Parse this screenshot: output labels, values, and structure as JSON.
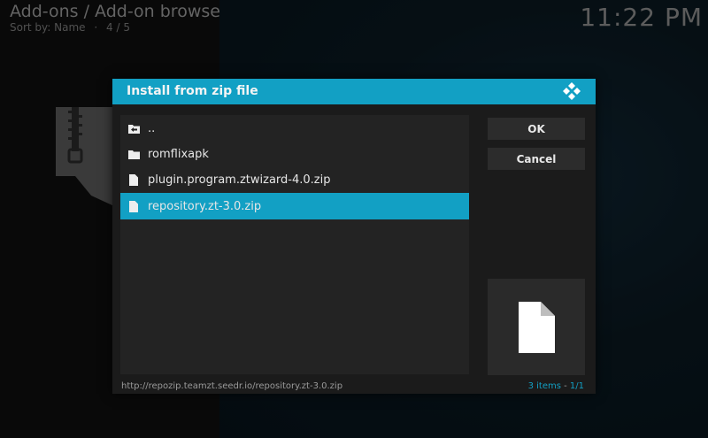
{
  "header": {
    "title": "Add-ons / Add-on browse",
    "sort_label": "Sort by: Name",
    "separator": "·",
    "position": "4 / 5",
    "clock": "11:22 PM"
  },
  "dialog": {
    "title": "Install from zip file",
    "items": [
      {
        "label": "..",
        "icon": "folder-up-icon"
      },
      {
        "label": "romflixapk",
        "icon": "folder-icon"
      },
      {
        "label": "plugin.program.ztwizard-4.0.zip",
        "icon": "file-icon"
      },
      {
        "label": "repository.zt-3.0.zip",
        "icon": "file-icon",
        "selected": true
      }
    ],
    "ok_label": "OK",
    "cancel_label": "Cancel",
    "footer_path": "http://repozip.teamzt.seedr.io/repository.zt-3.0.zip",
    "footer_count": "3 items",
    "footer_sep": " - ",
    "footer_page": "1/1"
  },
  "colors": {
    "accent": "#12a0c4",
    "dialog_bg": "#1b1b1b",
    "list_bg": "#232323"
  }
}
